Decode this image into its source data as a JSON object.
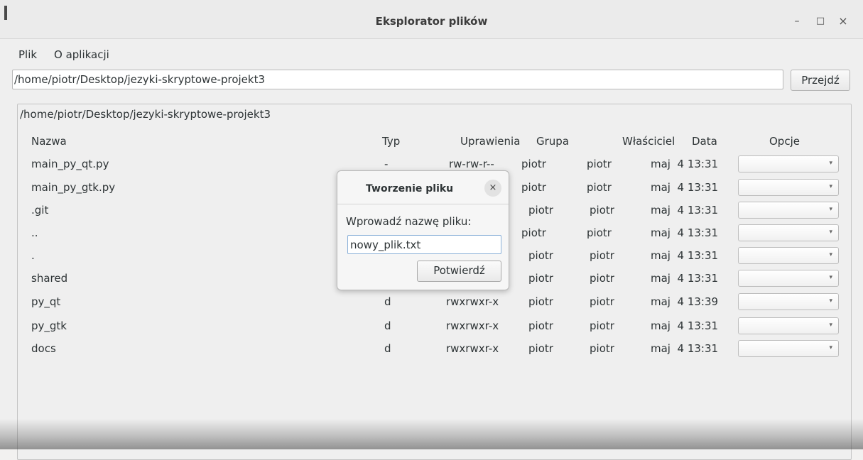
{
  "window": {
    "title": "Eksplorator plików",
    "controls": {
      "minimize": "–",
      "maximize": "□",
      "close": "×"
    }
  },
  "menu": {
    "items": [
      "Plik",
      "O aplikacji"
    ]
  },
  "path_bar": {
    "value": "/home/piotr/Desktop/jezyki-skryptowe-projekt3",
    "go_label": "Przejdź"
  },
  "browser": {
    "frame_label": "/home/piotr/Desktop/jezyki-skryptowe-projekt3",
    "columns": [
      "Nazwa",
      "Typ",
      "Uprawienia",
      "Grupa",
      "Właściciel",
      "Data",
      "Opcje"
    ],
    "rows": [
      {
        "name": "main_py_qt.py",
        "type": "-",
        "perms": "rw-rw-r--",
        "group": "piotr",
        "owner": "piotr",
        "date": "maj  4 13:31"
      },
      {
        "name": "main_py_gtk.py",
        "type": "",
        "perms": "",
        "group": "piotr",
        "owner": "piotr",
        "date": "maj  4 13:31"
      },
      {
        "name": ".git",
        "type": "",
        "perms": "",
        "group": "piotr",
        "owner": "piotr",
        "date": "maj  4 13:31"
      },
      {
        "name": "..",
        "type": "",
        "perms": "",
        "group": "piotr",
        "owner": "piotr",
        "date": "maj  4 13:31"
      },
      {
        "name": ".",
        "type": "",
        "perms": "",
        "group": "piotr",
        "owner": "piotr",
        "date": "maj  4 13:31"
      },
      {
        "name": "shared",
        "type": "",
        "perms": "",
        "group": "piotr",
        "owner": "piotr",
        "date": "maj  4 13:31"
      },
      {
        "name": "py_qt",
        "type": "d",
        "perms": "rwxrwxr-x",
        "group": "piotr",
        "owner": "piotr",
        "date": "maj  4 13:39"
      },
      {
        "name": "py_gtk",
        "type": "d",
        "perms": "rwxrwxr-x",
        "group": "piotr",
        "owner": "piotr",
        "date": "maj  4 13:31"
      },
      {
        "name": "docs",
        "type": "d",
        "perms": "rwxrwxr-x",
        "group": "piotr",
        "owner": "piotr",
        "date": "maj  4 13:31"
      }
    ],
    "options_value": ""
  },
  "dialog": {
    "title": "Tworzenie pliku",
    "close": "×",
    "prompt": "Wprowadź nazwę pliku:",
    "input_value": "nowy_plik.txt",
    "confirm_label": "Potwierdź"
  },
  "icons": {
    "combo_arrow": "▾"
  }
}
